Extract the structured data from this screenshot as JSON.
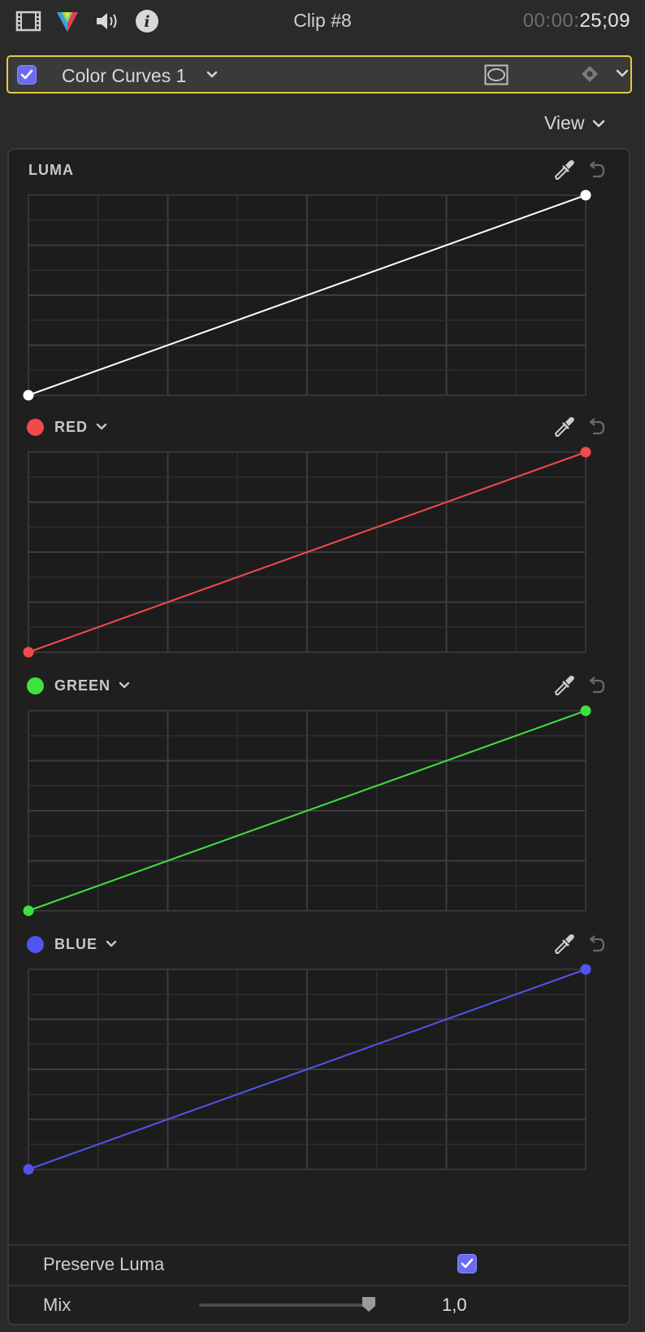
{
  "toolbar": {
    "icons": [
      "film-icon",
      "color-prism-icon",
      "speaker-icon",
      "info-icon"
    ],
    "clip_title": "Clip #8",
    "timecode_dim": "00:00:",
    "timecode_bright": "25;09"
  },
  "effect": {
    "enabled": true,
    "name": "Color Curves 1",
    "accent": "#e6c93a",
    "checkbox_color": "#6b6bf2"
  },
  "view_button": {
    "label": "View"
  },
  "curves": [
    {
      "id": "luma",
      "label": "LUMA",
      "color": "#ffffff",
      "has_dot": false,
      "has_dropdown": false,
      "start": [
        0,
        0
      ],
      "end": [
        1,
        1
      ]
    },
    {
      "id": "red",
      "label": "RED",
      "color": "#f24a4a",
      "has_dot": true,
      "has_dropdown": true,
      "start": [
        0,
        0
      ],
      "end": [
        1,
        1
      ]
    },
    {
      "id": "green",
      "label": "GREEN",
      "color": "#3ee23e",
      "has_dot": true,
      "has_dropdown": true,
      "start": [
        0,
        0
      ],
      "end": [
        1,
        1
      ]
    },
    {
      "id": "blue",
      "label": "BLUE",
      "color": "#5353f0",
      "has_dot": true,
      "has_dropdown": true,
      "start": [
        0,
        0
      ],
      "end": [
        1,
        1
      ]
    }
  ],
  "preserve_luma": {
    "label": "Preserve Luma",
    "checked": true
  },
  "mix": {
    "label": "Mix",
    "value": "1,0",
    "level": 1.0
  }
}
